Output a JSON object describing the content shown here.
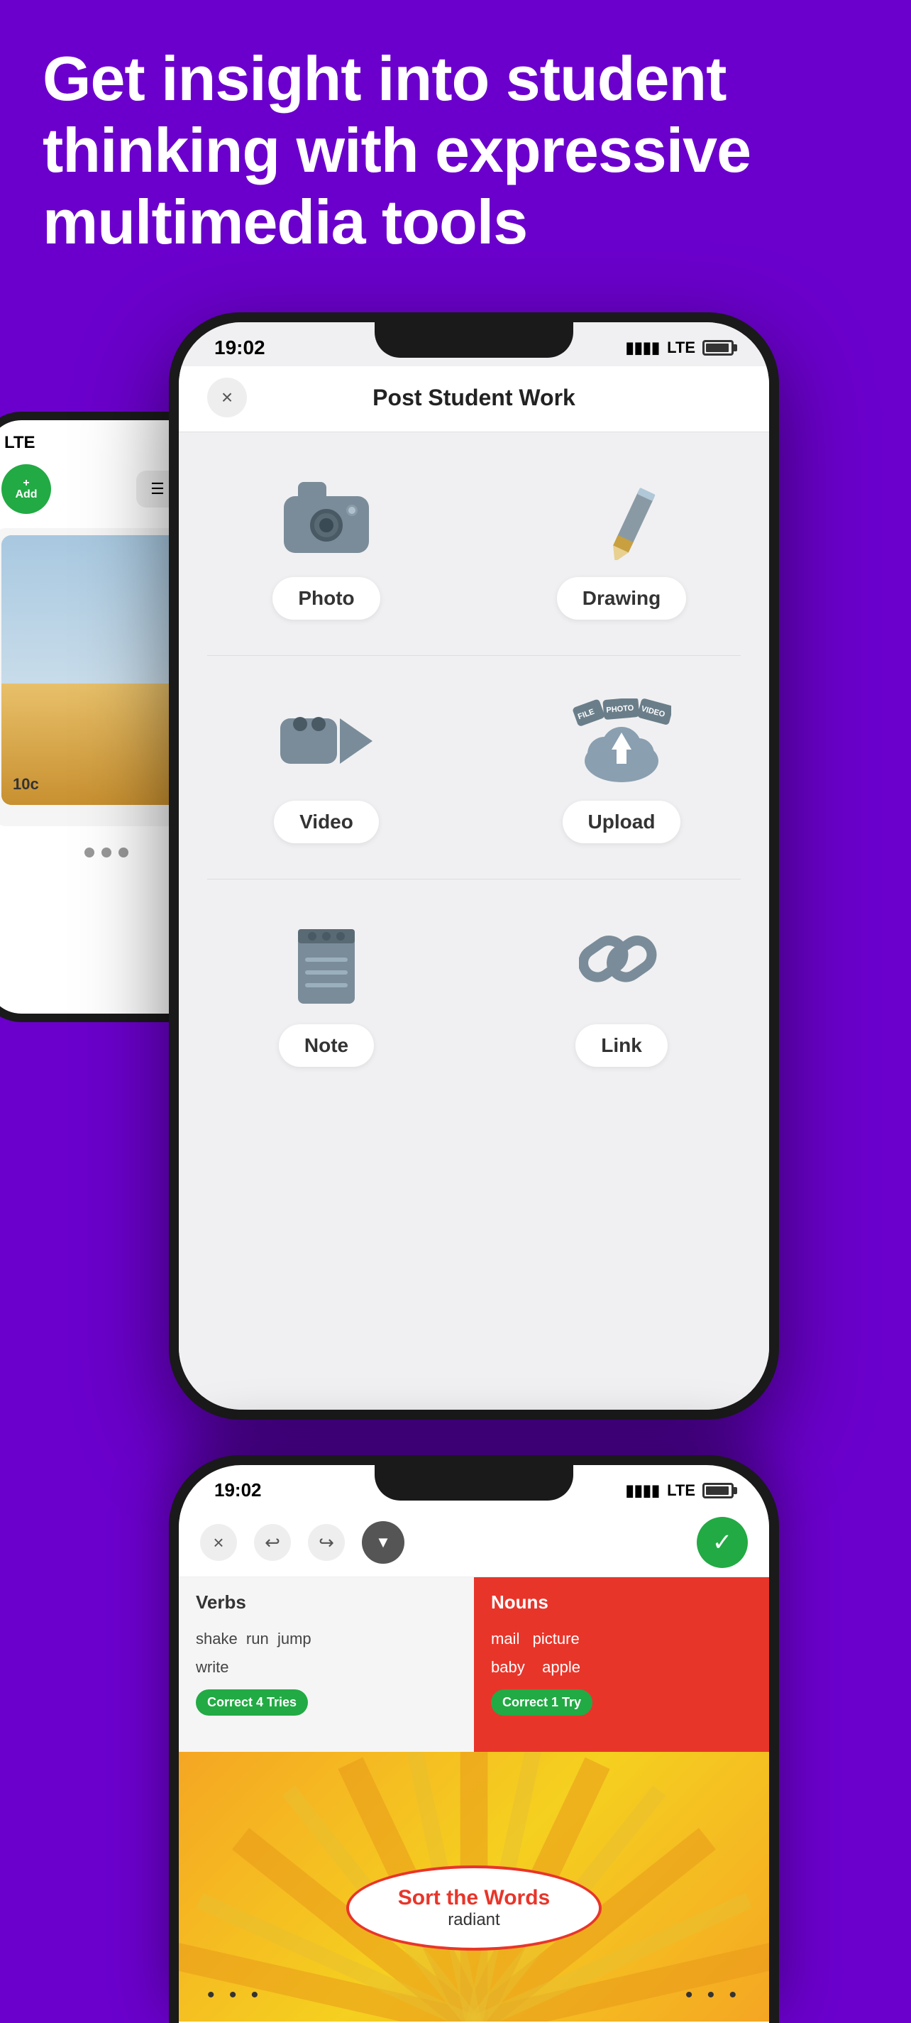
{
  "hero": {
    "text": "Get insight into student thinking with expressive multimedia tools"
  },
  "phone_left": {
    "status_time": "LTE",
    "battery": "■",
    "add_label": "Add",
    "price": "10c"
  },
  "phone_main": {
    "status": {
      "time": "19:02",
      "signal": "LTE",
      "battery": "■"
    },
    "nav": {
      "close_label": "×",
      "title": "Post Student Work"
    },
    "options": [
      {
        "id": "photo",
        "label": "Photo"
      },
      {
        "id": "drawing",
        "label": "Drawing"
      },
      {
        "id": "video",
        "label": "Video"
      },
      {
        "id": "upload",
        "label": "Upload"
      },
      {
        "id": "note",
        "label": "Note"
      },
      {
        "id": "link",
        "label": "Link"
      }
    ]
  },
  "phone_bottom": {
    "status": {
      "time": "19:02",
      "signal": "LTE",
      "battery": "■"
    },
    "toolbar": {
      "close": "×",
      "undo": "↩",
      "redo": "↪",
      "check": "✓"
    },
    "verbs": {
      "title": "Verbs",
      "words": "shake  run  jump\nwrite",
      "badge": "Correct 4 Tries"
    },
    "nouns": {
      "title": "Nouns",
      "words": "mail    picture\nbaby      apple",
      "badge": "Correct 1 Try"
    },
    "sort_words": {
      "title": "Sort the Words",
      "subtitle": "radiant"
    }
  }
}
